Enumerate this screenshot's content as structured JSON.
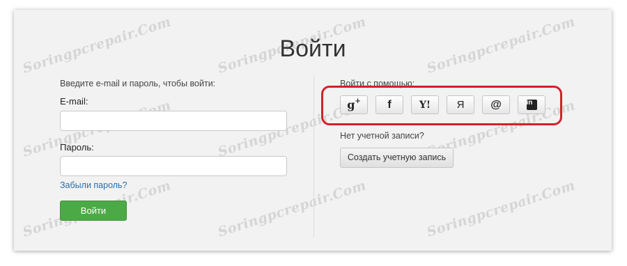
{
  "watermark_text": "Soringpcrepair.Com",
  "title": "Войти",
  "left": {
    "intro": "Введите e-mail и пароль, чтобы войти:",
    "email_label": "E-mail:",
    "email_value": "",
    "password_label": "Пароль:",
    "password_value": "",
    "forgot_link": "Забыли пароль?",
    "login_button": "Войти"
  },
  "right": {
    "with_label": "Войти с помощью:",
    "social": [
      {
        "name": "google-plus",
        "glyph": "g",
        "sup": "+"
      },
      {
        "name": "facebook",
        "glyph": "f"
      },
      {
        "name": "yahoo",
        "glyph": "Y!"
      },
      {
        "name": "yandex",
        "glyph": "Я"
      },
      {
        "name": "mail-ru",
        "glyph": "@"
      },
      {
        "name": "linkedin",
        "glyph": "in"
      }
    ],
    "no_account": "Нет учетной записи?",
    "create_button": "Создать учетную запись"
  },
  "colors": {
    "highlight": "#d4202a",
    "login_button": "#4caa46",
    "link": "#2a6ea6"
  }
}
